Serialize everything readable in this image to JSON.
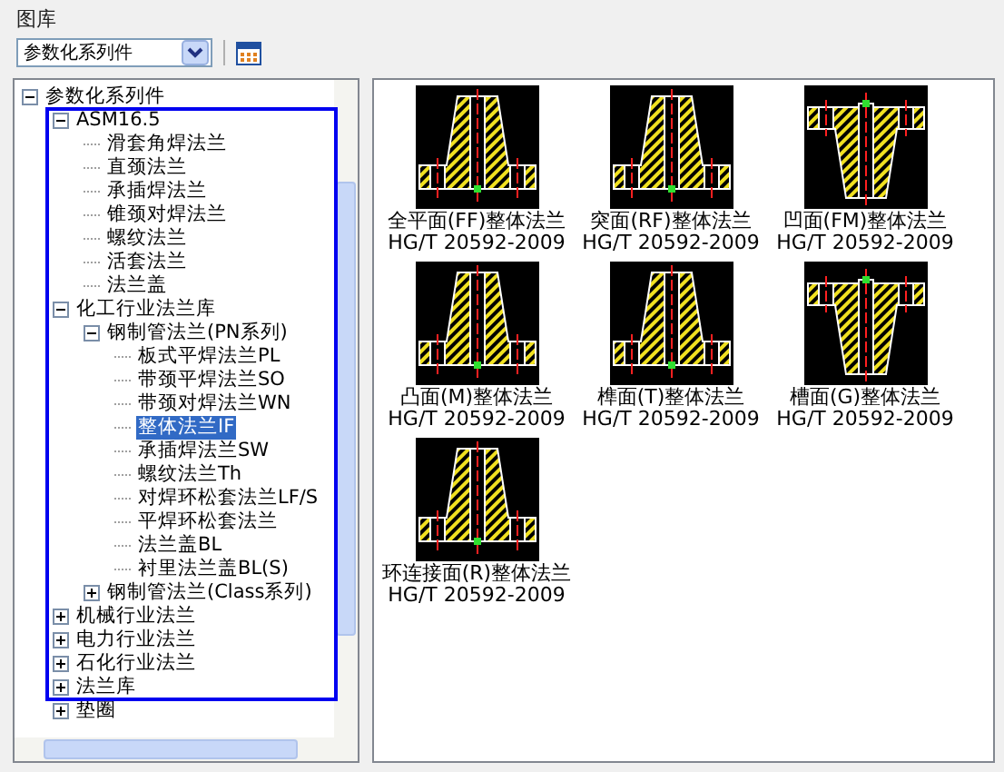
{
  "window": {
    "title": "图库"
  },
  "toolbar": {
    "dropdown": {
      "value": "参数化系列件"
    }
  },
  "tree": [
    {
      "label": "参数化系列件",
      "expanded": true,
      "selected": false,
      "children": [
        {
          "label": "ASM16.5",
          "expanded": true,
          "selected": false,
          "children": [
            {
              "label": "滑套角焊法兰",
              "selected": false
            },
            {
              "label": "直颈法兰",
              "selected": false
            },
            {
              "label": "承插焊法兰",
              "selected": false
            },
            {
              "label": "锥颈对焊法兰",
              "selected": false
            },
            {
              "label": "螺纹法兰",
              "selected": false
            },
            {
              "label": "活套法兰",
              "selected": false
            },
            {
              "label": "法兰盖",
              "selected": false
            }
          ]
        },
        {
          "label": "化工行业法兰库",
          "expanded": true,
          "selected": false,
          "children": [
            {
              "label": "钢制管法兰(PN系列)",
              "expanded": true,
              "selected": false,
              "children": [
                {
                  "label": "板式平焊法兰PL",
                  "selected": false
                },
                {
                  "label": "带颈平焊法兰SO",
                  "selected": false
                },
                {
                  "label": "带颈对焊法兰WN",
                  "selected": false
                },
                {
                  "label": "整体法兰IF",
                  "selected": true
                },
                {
                  "label": "承插焊法兰SW",
                  "selected": false
                },
                {
                  "label": "螺纹法兰Th",
                  "selected": false
                },
                {
                  "label": "对焊环松套法兰LF/S",
                  "selected": false
                },
                {
                  "label": "平焊环松套法兰",
                  "selected": false
                },
                {
                  "label": "法兰盖BL",
                  "selected": false
                },
                {
                  "label": "衬里法兰盖BL(S)",
                  "selected": false
                }
              ]
            },
            {
              "label": "钢制管法兰(Class系列)",
              "expanded": false,
              "selected": false
            }
          ]
        },
        {
          "label": "机械行业法兰",
          "expanded": false,
          "selected": false
        },
        {
          "label": "电力行业法兰",
          "expanded": false,
          "selected": false
        },
        {
          "label": "石化行业法兰",
          "expanded": false,
          "selected": false
        },
        {
          "label": "法兰库",
          "expanded": false,
          "selected": false
        },
        {
          "label": "垫圈",
          "expanded": false,
          "selected": false
        }
      ]
    }
  ],
  "gallery": [
    {
      "caption": "全平面(FF)整体法兰 HG/T 20592-2009",
      "kind": "hub-up"
    },
    {
      "caption": "突面(RF)整体法兰 HG/T 20592-2009",
      "kind": "hub-up"
    },
    {
      "caption": "凹面(FM)整体法兰 HG/T 20592-2009",
      "kind": "hub-down"
    },
    {
      "caption": "凸面(M)整体法兰 HG/T 20592-2009",
      "kind": "hub-up"
    },
    {
      "caption": "榫面(T)整体法兰 HG/T 20592-2009",
      "kind": "hub-up"
    },
    {
      "caption": "槽面(G)整体法兰 HG/T 20592-2009",
      "kind": "hub-down"
    },
    {
      "caption": "环连接面(R)整体法兰 HG/T 20592-2009",
      "kind": "hub-up"
    }
  ]
}
